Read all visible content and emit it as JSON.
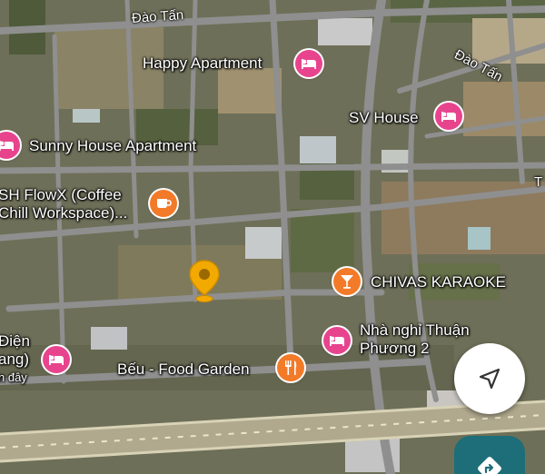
{
  "map": {
    "streets": [
      {
        "label": "Đào Tấn"
      },
      {
        "label": "Đào Tấn"
      },
      {
        "label": "T"
      }
    ],
    "places": [
      {
        "label": "Happy Apartment",
        "icon": "hotel-icon",
        "color": "#e8448e"
      },
      {
        "label": "SV House",
        "icon": "hotel-icon",
        "color": "#e8448e"
      },
      {
        "label": "Sunny House Apartment",
        "icon": "hotel-icon",
        "color": "#e8448e"
      },
      {
        "label_line1": "SH FlowX (Coffee",
        "label_line2": "Chill Workspace)...",
        "icon": "coffee-icon",
        "color": "#f27a29"
      },
      {
        "label": "CHIVAS KARAOKE",
        "icon": "bar-icon",
        "color": "#f27a29"
      },
      {
        "label_line1": "Nhà nghỉ Thuận",
        "label_line2": "Phương 2",
        "icon": "hotel-icon",
        "color": "#e8448e"
      },
      {
        "label": "Bếu - Food Garden",
        "icon": "restaurant-icon",
        "color": "#f27a29"
      },
      {
        "label_line1": "Điện",
        "label_line2": "ang)",
        "label_line3": "n đây",
        "icon": "hotel-icon",
        "color": "#e8448e"
      }
    ],
    "selected_pin": {
      "icon": "location-pin-icon",
      "color": "#f2a900"
    }
  },
  "controls": {
    "navigate_icon": "navigation-arrow-icon",
    "directions_icon": "directions-icon",
    "directions_color": "#1d6e78"
  }
}
